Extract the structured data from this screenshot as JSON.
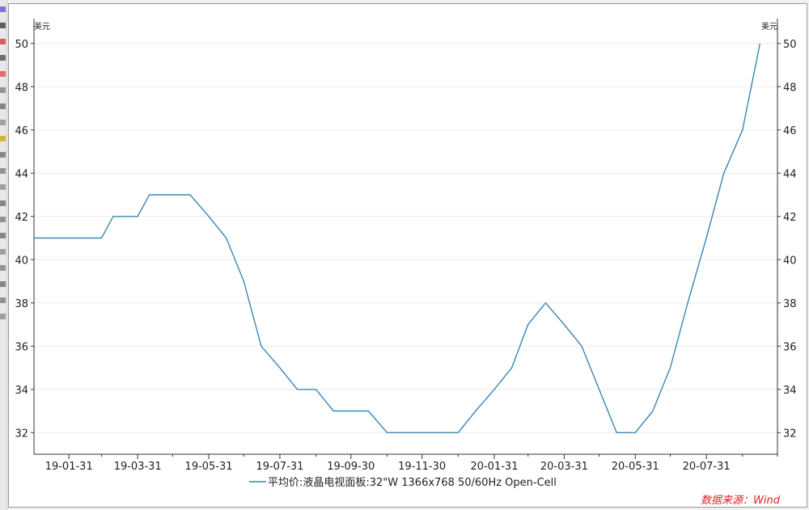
{
  "chart_data": {
    "type": "line",
    "y_unit_left": "美元",
    "y_unit_right": "美元",
    "ylim": [
      31,
      51
    ],
    "yticks": [
      32,
      34,
      36,
      38,
      40,
      42,
      44,
      46,
      48,
      50
    ],
    "x_tick_labels": [
      "19-01-31",
      "19-03-31",
      "19-05-31",
      "19-07-31",
      "19-09-30",
      "19-11-30",
      "20-01-31",
      "20-03-31",
      "20-05-31",
      "20-07-31"
    ],
    "x_range": [
      "2019-01-01",
      "2020-09-30"
    ],
    "grid": "horizontal",
    "legend_position": "bottom",
    "line_color": "#3a87b8",
    "series": [
      {
        "name": "平均价:液晶电视面板:32\"W 1366x768 50/60Hz Open-Cell",
        "points": [
          {
            "x": "2019-01-01",
            "y": 41
          },
          {
            "x": "2019-01-31",
            "y": 41
          },
          {
            "x": "2019-02-28",
            "y": 41
          },
          {
            "x": "2019-03-10",
            "y": 42
          },
          {
            "x": "2019-03-31",
            "y": 42
          },
          {
            "x": "2019-04-10",
            "y": 43
          },
          {
            "x": "2019-04-30",
            "y": 43
          },
          {
            "x": "2019-05-15",
            "y": 43
          },
          {
            "x": "2019-05-31",
            "y": 42
          },
          {
            "x": "2019-06-15",
            "y": 41
          },
          {
            "x": "2019-06-30",
            "y": 39
          },
          {
            "x": "2019-07-15",
            "y": 36
          },
          {
            "x": "2019-07-31",
            "y": 35
          },
          {
            "x": "2019-08-15",
            "y": 34
          },
          {
            "x": "2019-08-31",
            "y": 34
          },
          {
            "x": "2019-09-15",
            "y": 33
          },
          {
            "x": "2019-09-30",
            "y": 33
          },
          {
            "x": "2019-10-15",
            "y": 33
          },
          {
            "x": "2019-10-31",
            "y": 32
          },
          {
            "x": "2019-11-30",
            "y": 32
          },
          {
            "x": "2019-12-31",
            "y": 32
          },
          {
            "x": "2020-01-15",
            "y": 33
          },
          {
            "x": "2020-01-31",
            "y": 34
          },
          {
            "x": "2020-02-15",
            "y": 35
          },
          {
            "x": "2020-02-29",
            "y": 37
          },
          {
            "x": "2020-03-15",
            "y": 38
          },
          {
            "x": "2020-03-31",
            "y": 37
          },
          {
            "x": "2020-04-15",
            "y": 36
          },
          {
            "x": "2020-04-30",
            "y": 34
          },
          {
            "x": "2020-05-15",
            "y": 32
          },
          {
            "x": "2020-05-31",
            "y": 32
          },
          {
            "x": "2020-06-15",
            "y": 33
          },
          {
            "x": "2020-06-30",
            "y": 35
          },
          {
            "x": "2020-07-15",
            "y": 38
          },
          {
            "x": "2020-07-31",
            "y": 41
          },
          {
            "x": "2020-08-15",
            "y": 44
          },
          {
            "x": "2020-08-31",
            "y": 46
          },
          {
            "x": "2020-09-15",
            "y": 50
          }
        ]
      }
    ],
    "source": "数据来源：Wind"
  },
  "toolbar": {
    "icons": [
      "close-icon",
      "color-icon",
      "flag-icon",
      "chart-icon",
      "pie-icon",
      "cursor-icon",
      "select-icon",
      "arrow-icon",
      "box-icon",
      "text-icon",
      "grid-icon",
      "table-icon",
      "copy-icon",
      "shape-icon",
      "diamond-icon",
      "edit-icon",
      "rect-icon",
      "square-icon",
      "circle-icon",
      "dot-icon"
    ]
  }
}
